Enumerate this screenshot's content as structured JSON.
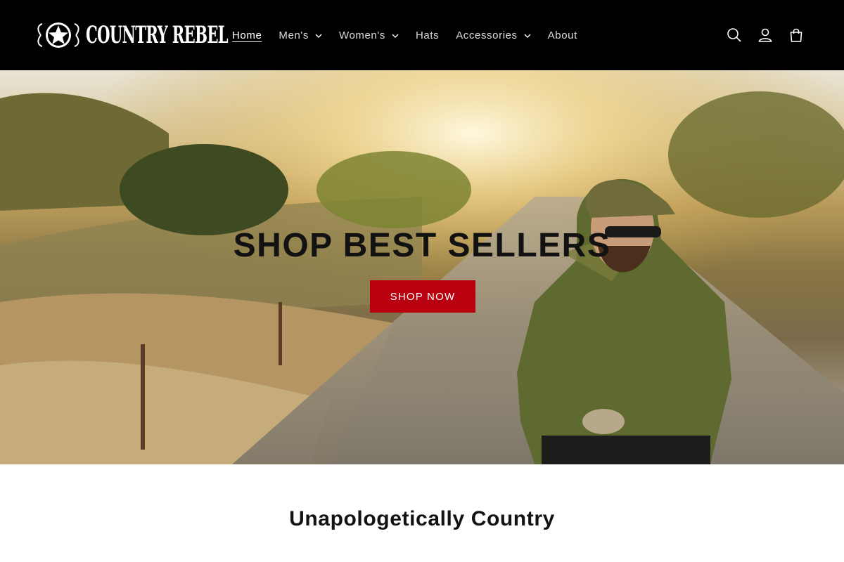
{
  "header": {
    "logo_text": "COUNTRY REBEL",
    "nav": [
      {
        "label": "Home",
        "active": true,
        "has_dropdown": false
      },
      {
        "label": "Men's",
        "has_dropdown": true
      },
      {
        "label": "Women's",
        "has_dropdown": true
      },
      {
        "label": "Hats",
        "has_dropdown": false
      },
      {
        "label": "Accessories",
        "has_dropdown": true
      },
      {
        "label": "About",
        "has_dropdown": false
      }
    ],
    "icons": [
      "search-icon",
      "account-icon",
      "cart-icon"
    ]
  },
  "hero": {
    "title": "SHOP BEST SELLERS",
    "button_label": "SHOP NOW"
  },
  "featured": {
    "title": "Unapologetically Country"
  },
  "colors": {
    "header_bg": "#000000",
    "accent": "#b8000e",
    "text": "#121212"
  }
}
